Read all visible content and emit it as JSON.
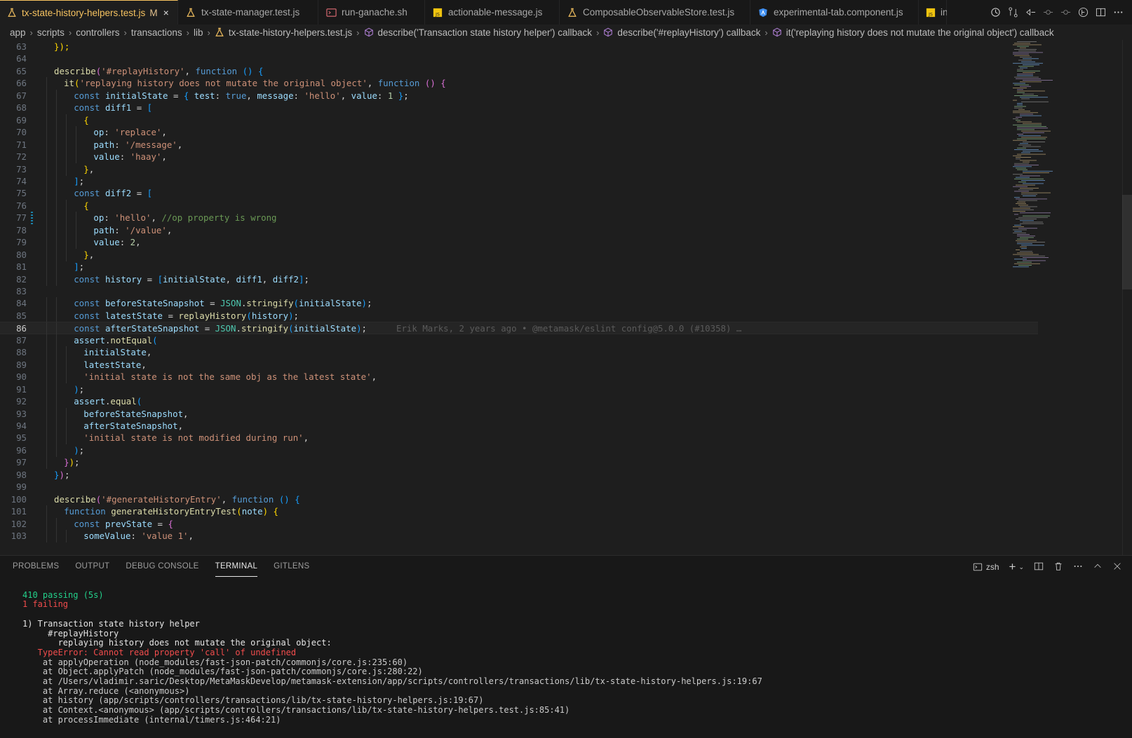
{
  "tabs": [
    {
      "label": "tx-state-history-helpers.test.js",
      "icon": "test-flask-icon",
      "active": true,
      "modified": "M"
    },
    {
      "label": "tx-state-manager.test.js",
      "icon": "test-flask-icon",
      "active": false
    },
    {
      "label": "run-ganache.sh",
      "icon": "terminal-script-icon",
      "active": false
    },
    {
      "label": "actionable-message.js",
      "icon": "javascript-file-icon",
      "active": false
    },
    {
      "label": "ComposableObservableStore.test.js",
      "icon": "test-flask-icon",
      "active": false
    },
    {
      "label": "experimental-tab.component.js",
      "icon": "angular-icon",
      "active": false
    },
    {
      "label": "in",
      "icon": "javascript-file-icon",
      "active": false
    }
  ],
  "close_glyph": "×",
  "breadcrumb": [
    "app",
    "scripts",
    "controllers",
    "transactions",
    "lib",
    "tx-state-history-helpers.test.js",
    "describe('Transaction state history helper') callback",
    "describe('#replayHistory') callback",
    "it('replaying history does not mutate the original object') callback"
  ],
  "editor": {
    "current_line": 86,
    "blame": "Erik Marks, 2 years ago • @metamask/eslint config@5.0.0 (#10358) …"
  },
  "panel": {
    "tabs": [
      "PROBLEMS",
      "OUTPUT",
      "DEBUG CONSOLE",
      "TERMINAL",
      "GITLENS"
    ],
    "active_tab": "TERMINAL",
    "shell": "zsh"
  },
  "terminal": {
    "passing": "410 passing (5s)",
    "failing": "1 failing",
    "failure_title": "1) Transaction state history helper",
    "failure_suite": "     #replayHistory",
    "failure_test": "       replaying history does not mutate the original object:",
    "error": "   TypeError: Cannot read property 'call' of undefined",
    "stack": [
      "    at applyOperation (node_modules/fast-json-patch/commonjs/core.js:235:60)",
      "    at Object.applyPatch (node_modules/fast-json-patch/commonjs/core.js:280:22)",
      "    at /Users/vladimir.saric/Desktop/MetaMaskDevelop/metamask-extension/app/scripts/controllers/transactions/lib/tx-state-history-helpers.js:19:67",
      "    at Array.reduce (<anonymous>)",
      "    at history (app/scripts/controllers/transactions/lib/tx-state-history-helpers.js:19:67)",
      "    at Context.<anonymous> (app/scripts/controllers/transactions/lib/tx-state-history-helpers.test.js:85:41)",
      "    at processImmediate (internal/timers.js:464:21)"
    ]
  },
  "code_lines": [
    {
      "n": "63",
      "i": 1,
      "t": [
        [
          "b1",
          "});"
        ]
      ]
    },
    {
      "n": "64",
      "i": 0,
      "t": []
    },
    {
      "n": "65",
      "i": 1,
      "t": [
        [
          "f",
          "describe"
        ],
        [
          "b2",
          "("
        ],
        [
          "s",
          "'#replayHistory'"
        ],
        [
          "p",
          ", "
        ],
        [
          "k",
          "function"
        ],
        [
          "p",
          " "
        ],
        [
          "b3",
          "()"
        ],
        [
          "p",
          " "
        ],
        [
          "b3",
          "{"
        ]
      ]
    },
    {
      "n": "66",
      "i": 2,
      "t": [
        [
          "f",
          "it"
        ],
        [
          "b1",
          "("
        ],
        [
          "s",
          "'replaying history does not mutate the original object'"
        ],
        [
          "p",
          ", "
        ],
        [
          "k",
          "function"
        ],
        [
          "p",
          " "
        ],
        [
          "b2",
          "()"
        ],
        [
          "p",
          " "
        ],
        [
          "b2",
          "{"
        ]
      ]
    },
    {
      "n": "67",
      "i": 3,
      "t": [
        [
          "k",
          "const "
        ],
        [
          "v",
          "initialState"
        ],
        [
          "p",
          " = "
        ],
        [
          "b3",
          "{ "
        ],
        [
          "v",
          "test"
        ],
        [
          "p",
          ": "
        ],
        [
          "k",
          "true"
        ],
        [
          "p",
          ", "
        ],
        [
          "v",
          "message"
        ],
        [
          "p",
          ": "
        ],
        [
          "s",
          "'hello'"
        ],
        [
          "p",
          ", "
        ],
        [
          "v",
          "value"
        ],
        [
          "p",
          ": "
        ],
        [
          "n",
          "1"
        ],
        [
          "p",
          " "
        ],
        [
          "b3",
          "}"
        ],
        [
          "p",
          ";"
        ]
      ]
    },
    {
      "n": "68",
      "i": 3,
      "t": [
        [
          "k",
          "const "
        ],
        [
          "v",
          "diff1"
        ],
        [
          "p",
          " = "
        ],
        [
          "b3",
          "["
        ]
      ]
    },
    {
      "n": "69",
      "i": 4,
      "t": [
        [
          "b1",
          "{"
        ]
      ]
    },
    {
      "n": "70",
      "i": 5,
      "t": [
        [
          "v",
          "op"
        ],
        [
          "p",
          ": "
        ],
        [
          "s",
          "'replace'"
        ],
        [
          "p",
          ","
        ]
      ]
    },
    {
      "n": "71",
      "i": 5,
      "t": [
        [
          "v",
          "path"
        ],
        [
          "p",
          ": "
        ],
        [
          "s",
          "'/message'"
        ],
        [
          "p",
          ","
        ]
      ]
    },
    {
      "n": "72",
      "i": 5,
      "t": [
        [
          "v",
          "value"
        ],
        [
          "p",
          ": "
        ],
        [
          "s",
          "'haay'"
        ],
        [
          "p",
          ","
        ]
      ]
    },
    {
      "n": "73",
      "i": 4,
      "t": [
        [
          "b1",
          "}"
        ],
        [
          "p",
          ","
        ]
      ]
    },
    {
      "n": "74",
      "i": 3,
      "t": [
        [
          "b3",
          "]"
        ],
        [
          "p",
          ";"
        ]
      ]
    },
    {
      "n": "75",
      "i": 3,
      "t": [
        [
          "k",
          "const "
        ],
        [
          "v",
          "diff2"
        ],
        [
          "p",
          " = "
        ],
        [
          "b3",
          "["
        ]
      ]
    },
    {
      "n": "76",
      "i": 4,
      "t": [
        [
          "b1",
          "{"
        ]
      ]
    },
    {
      "n": "77",
      "i": 5,
      "t": [
        [
          "v",
          "op"
        ],
        [
          "p",
          ": "
        ],
        [
          "s",
          "'hello'"
        ],
        [
          "p",
          ", "
        ],
        [
          "c",
          "//op property is wrong"
        ]
      ],
      "mod": true
    },
    {
      "n": "78",
      "i": 5,
      "t": [
        [
          "v",
          "path"
        ],
        [
          "p",
          ": "
        ],
        [
          "s",
          "'/value'"
        ],
        [
          "p",
          ","
        ]
      ]
    },
    {
      "n": "79",
      "i": 5,
      "t": [
        [
          "v",
          "value"
        ],
        [
          "p",
          ": "
        ],
        [
          "n",
          "2"
        ],
        [
          "p",
          ","
        ]
      ]
    },
    {
      "n": "80",
      "i": 4,
      "t": [
        [
          "b1",
          "}"
        ],
        [
          "p",
          ","
        ]
      ]
    },
    {
      "n": "81",
      "i": 3,
      "t": [
        [
          "b3",
          "]"
        ],
        [
          "p",
          ";"
        ]
      ]
    },
    {
      "n": "82",
      "i": 3,
      "t": [
        [
          "k",
          "const "
        ],
        [
          "v",
          "history"
        ],
        [
          "p",
          " = "
        ],
        [
          "b3",
          "["
        ],
        [
          "v",
          "initialState"
        ],
        [
          "p",
          ", "
        ],
        [
          "v",
          "diff1"
        ],
        [
          "p",
          ", "
        ],
        [
          "v",
          "diff2"
        ],
        [
          "b3",
          "]"
        ],
        [
          "p",
          ";"
        ]
      ]
    },
    {
      "n": "83",
      "i": 0,
      "t": []
    },
    {
      "n": "84",
      "i": 3,
      "t": [
        [
          "k",
          "const "
        ],
        [
          "v",
          "beforeStateSnapshot"
        ],
        [
          "p",
          " = "
        ],
        [
          "cl",
          "JSON"
        ],
        [
          "p",
          "."
        ],
        [
          "f",
          "stringify"
        ],
        [
          "b3",
          "("
        ],
        [
          "v",
          "initialState"
        ],
        [
          "b3",
          ")"
        ],
        [
          "p",
          ";"
        ]
      ]
    },
    {
      "n": "85",
      "i": 3,
      "t": [
        [
          "k",
          "const "
        ],
        [
          "v",
          "latestState"
        ],
        [
          "p",
          " = "
        ],
        [
          "f",
          "replayHistory"
        ],
        [
          "b3",
          "("
        ],
        [
          "v",
          "history"
        ],
        [
          "b3",
          ")"
        ],
        [
          "p",
          ";"
        ]
      ]
    },
    {
      "n": "86",
      "i": 3,
      "t": [
        [
          "k",
          "const "
        ],
        [
          "v",
          "afterStateSnapshot"
        ],
        [
          "p",
          " = "
        ],
        [
          "cl",
          "JSON"
        ],
        [
          "p",
          "."
        ],
        [
          "f",
          "stringify"
        ],
        [
          "b3",
          "("
        ],
        [
          "v",
          "initialState"
        ],
        [
          "b3",
          ")"
        ],
        [
          "p",
          ";"
        ]
      ]
    },
    {
      "n": "87",
      "i": 3,
      "t": [
        [
          "v",
          "assert"
        ],
        [
          "p",
          "."
        ],
        [
          "f",
          "notEqual"
        ],
        [
          "b3",
          "("
        ]
      ]
    },
    {
      "n": "88",
      "i": 4,
      "t": [
        [
          "v",
          "initialState"
        ],
        [
          "p",
          ","
        ]
      ]
    },
    {
      "n": "89",
      "i": 4,
      "t": [
        [
          "v",
          "latestState"
        ],
        [
          "p",
          ","
        ]
      ]
    },
    {
      "n": "90",
      "i": 4,
      "t": [
        [
          "s",
          "'initial state is not the same obj as the latest state'"
        ],
        [
          "p",
          ","
        ]
      ]
    },
    {
      "n": "91",
      "i": 3,
      "t": [
        [
          "b3",
          ")"
        ],
        [
          "p",
          ";"
        ]
      ]
    },
    {
      "n": "92",
      "i": 3,
      "t": [
        [
          "v",
          "assert"
        ],
        [
          "p",
          "."
        ],
        [
          "f",
          "equal"
        ],
        [
          "b3",
          "("
        ]
      ]
    },
    {
      "n": "93",
      "i": 4,
      "t": [
        [
          "v",
          "beforeStateSnapshot"
        ],
        [
          "p",
          ","
        ]
      ]
    },
    {
      "n": "94",
      "i": 4,
      "t": [
        [
          "v",
          "afterStateSnapshot"
        ],
        [
          "p",
          ","
        ]
      ]
    },
    {
      "n": "95",
      "i": 4,
      "t": [
        [
          "s",
          "'initial state is not modified during run'"
        ],
        [
          "p",
          ","
        ]
      ]
    },
    {
      "n": "96",
      "i": 3,
      "t": [
        [
          "b3",
          ")"
        ],
        [
          "p",
          ";"
        ]
      ]
    },
    {
      "n": "97",
      "i": 2,
      "t": [
        [
          "b2",
          "}"
        ],
        [
          "b1",
          ")"
        ],
        [
          "p",
          ";"
        ]
      ]
    },
    {
      "n": "98",
      "i": 1,
      "t": [
        [
          "b3",
          "}"
        ],
        [
          "b2",
          ")"
        ],
        [
          "p",
          ";"
        ]
      ]
    },
    {
      "n": "99",
      "i": 0,
      "t": []
    },
    {
      "n": "100",
      "i": 1,
      "t": [
        [
          "f",
          "describe"
        ],
        [
          "b2",
          "("
        ],
        [
          "s",
          "'#generateHistoryEntry'"
        ],
        [
          "p",
          ", "
        ],
        [
          "k",
          "function"
        ],
        [
          "p",
          " "
        ],
        [
          "b3",
          "()"
        ],
        [
          "p",
          " "
        ],
        [
          "b3",
          "{"
        ]
      ]
    },
    {
      "n": "101",
      "i": 2,
      "t": [
        [
          "k",
          "function "
        ],
        [
          "f",
          "generateHistoryEntryTest"
        ],
        [
          "b1",
          "("
        ],
        [
          "v",
          "note"
        ],
        [
          "b1",
          ")"
        ],
        [
          "p",
          " "
        ],
        [
          "b1",
          "{"
        ]
      ]
    },
    {
      "n": "102",
      "i": 3,
      "t": [
        [
          "k",
          "const "
        ],
        [
          "v",
          "prevState"
        ],
        [
          "p",
          " = "
        ],
        [
          "b2",
          "{"
        ]
      ]
    },
    {
      "n": "103",
      "i": 4,
      "t": [
        [
          "v",
          "someValue"
        ],
        [
          "p",
          ": "
        ],
        [
          "s",
          "'value 1'"
        ],
        [
          "p",
          ","
        ]
      ]
    }
  ]
}
